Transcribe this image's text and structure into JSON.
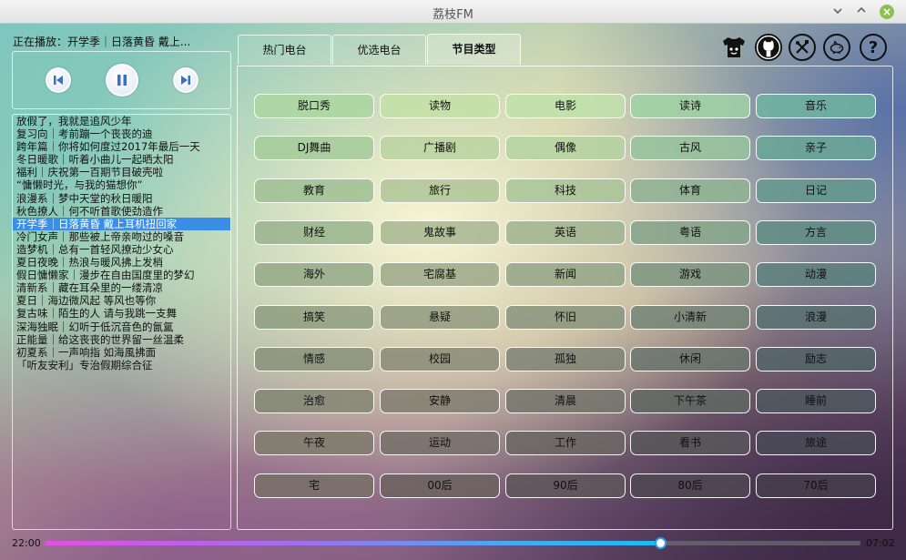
{
  "window": {
    "title": "荔枝FM"
  },
  "player": {
    "now_playing_label": "正在播放：开学季｜日落黄昏 戴上...",
    "elapsed": "22:00",
    "total": "07:02",
    "progress": 0.755
  },
  "tabs": [
    {
      "label": "热门电台"
    },
    {
      "label": "优选电台"
    },
    {
      "label": "节目类型",
      "selected": true
    }
  ],
  "toolbar_icons": [
    "shirt-icon",
    "github-icon",
    "tools-icon",
    "piggy-bank-icon",
    "help-icon"
  ],
  "playlist": {
    "active_index": 8,
    "items": [
      "放假了，我就是追风少年",
      "复习向｜考前蹦一个丧丧的迪",
      "跨年篇｜你将如何度过2017年最后一天",
      "冬日暖歌｜听着小曲儿一起晒太阳",
      "福利｜庆祝第一百期节目破壳啦",
      "“慵懒时光，与我的猫想你”",
      "浪漫系｜梦中天堂的秋日暖阳",
      "秋色撩人｜何不听首歌使劲造作",
      "开学季｜日落黄昏 戴上耳机扭回家",
      "冷门女声｜那些被上帝亲吻过的嗓音",
      "造梦机｜总有一首轻风撩动少女心",
      "夏日夜晚｜热浪与暖风拂上发梢",
      "假日慵懒家｜漫步在自由国度里的梦幻",
      "清新系｜藏在耳朵里的一缕清凉",
      "夏日｜海边微风起 等风也等你",
      "复古味｜陌生的人 请与我跳一支舞",
      "深海独眠｜幻听于低沉音色的氤氲",
      "正能量｜给这丧丧的世界留一丝温柔",
      "初夏系｜一声响指 如海風拂面",
      "「听友安利」专治假期综合征"
    ]
  },
  "categories": [
    "脱口秀",
    "读物",
    "电影",
    "读诗",
    "音乐",
    "DJ舞曲",
    "广播剧",
    "偶像",
    "古风",
    "亲子",
    "教育",
    "旅行",
    "科技",
    "体育",
    "日记",
    "财经",
    "鬼故事",
    "英语",
    "粤语",
    "方言",
    "海外",
    "宅腐基",
    "新闻",
    "游戏",
    "动漫",
    "搞笑",
    "悬疑",
    "怀旧",
    "小清新",
    "浪漫",
    "情感",
    "校园",
    "孤独",
    "休闲",
    "励志",
    "治愈",
    "安静",
    "清晨",
    "下午茶",
    "睡前",
    "午夜",
    "运动",
    "工作",
    "看书",
    "旅途",
    "宅",
    "00后",
    "90后",
    "80后",
    "70后"
  ]
}
